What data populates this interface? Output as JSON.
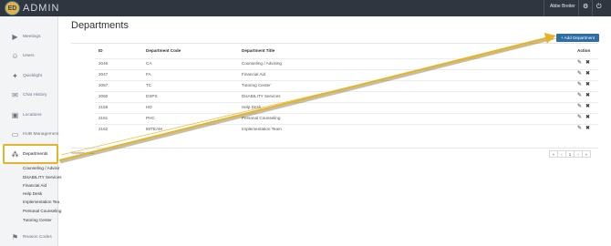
{
  "app": {
    "logo_badge": "ED",
    "logo_text": "ADMIN",
    "user_name": "Abbe Breiter"
  },
  "topbar_icons": [
    {
      "name": "gear-icon",
      "glyph": "⚙"
    },
    {
      "name": "power-icon",
      "glyph": "⏻"
    }
  ],
  "sidebar": {
    "items": [
      {
        "label": "Meetings",
        "icon": "video-camera-icon",
        "glyph": "▶"
      },
      {
        "label": "Users",
        "icon": "users-icon",
        "glyph": "☺"
      },
      {
        "label": "Quicklight",
        "icon": "quicklight-icon",
        "glyph": "✦"
      },
      {
        "label": "Chat History",
        "icon": "chat-icon",
        "glyph": "✉"
      },
      {
        "label": "Locations",
        "icon": "building-icon",
        "glyph": "▣"
      },
      {
        "label": "HUB Management",
        "icon": "monitor-icon",
        "glyph": "▭"
      },
      {
        "label": "Departments",
        "icon": "sitemap-icon",
        "glyph": "⁂",
        "active": true
      }
    ],
    "sub_items": [
      "Counseling / Advisir",
      "DisABILITY Services",
      "Financial Aid",
      "Help Desk",
      "Implementation Tea",
      "Personal Counseling",
      "Tutoring Center"
    ],
    "bottom_item": {
      "label": "Reason Codes",
      "icon": "flag-icon",
      "glyph": "⚑"
    }
  },
  "main": {
    "title": "Departments",
    "add_button": "+ Add Department",
    "columns": {
      "id": "ID",
      "code": "Department Code",
      "title": "Department Title",
      "action": "Action"
    },
    "rows": [
      {
        "id": "2046",
        "code": "CA",
        "title": "Counseling / Advising"
      },
      {
        "id": "2047",
        "code": "FA",
        "title": "Financial Aid"
      },
      {
        "id": "2057",
        "code": "TC",
        "title": "Tutoring Center"
      },
      {
        "id": "2060",
        "code": "DSPS",
        "title": "DisABILITY Services"
      },
      {
        "id": "2159",
        "code": "HD",
        "title": "Help Desk"
      },
      {
        "id": "2161",
        "code": "PHC",
        "title": "Personal Counseling"
      },
      {
        "id": "2162",
        "code": "IMTEAM",
        "title": "Implementation Team"
      }
    ],
    "edit_glyph": "✎",
    "delete_glyph": "✖",
    "showing_text": "Showing rows",
    "pagination": [
      "«",
      "‹",
      "1",
      "›",
      "»"
    ]
  },
  "colors": {
    "topbar": "#2f3640",
    "accent_button": "#2d6ea6",
    "highlight": "#e5b42b"
  }
}
